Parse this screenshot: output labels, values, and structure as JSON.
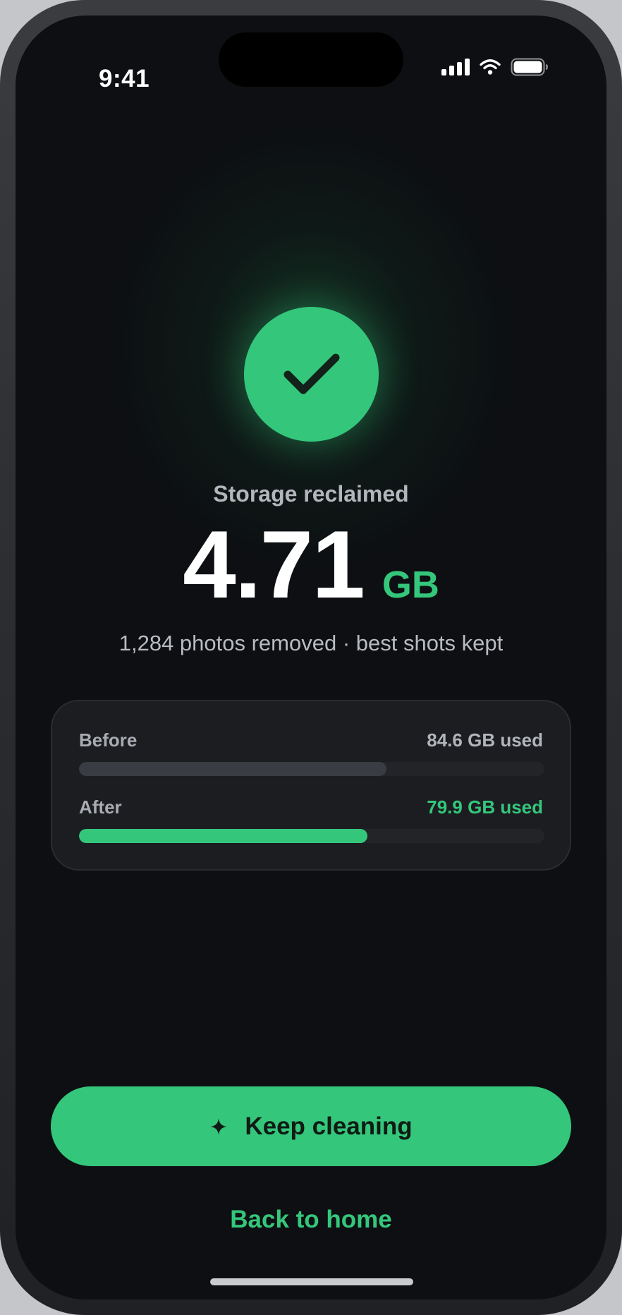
{
  "status_bar": {
    "time": "9:41"
  },
  "hero": {
    "label": "Storage reclaimed",
    "amount": "4.71",
    "unit": "GB",
    "detail": "1,284 photos removed · best shots kept"
  },
  "storage": {
    "before": {
      "label": "Before",
      "value": "84.6 GB used",
      "fill_fraction": 0.66
    },
    "after": {
      "label": "After",
      "value": "79.9 GB used",
      "fill_fraction": 0.62
    }
  },
  "actions": {
    "primary_label": "Keep cleaning",
    "primary_icon": "sparkle-icon",
    "secondary_label": "Back to home"
  },
  "colors": {
    "accent": "#34c77b",
    "background": "#0d0f12",
    "card": "#1c1d21",
    "before_bar": "#3a3c44"
  }
}
